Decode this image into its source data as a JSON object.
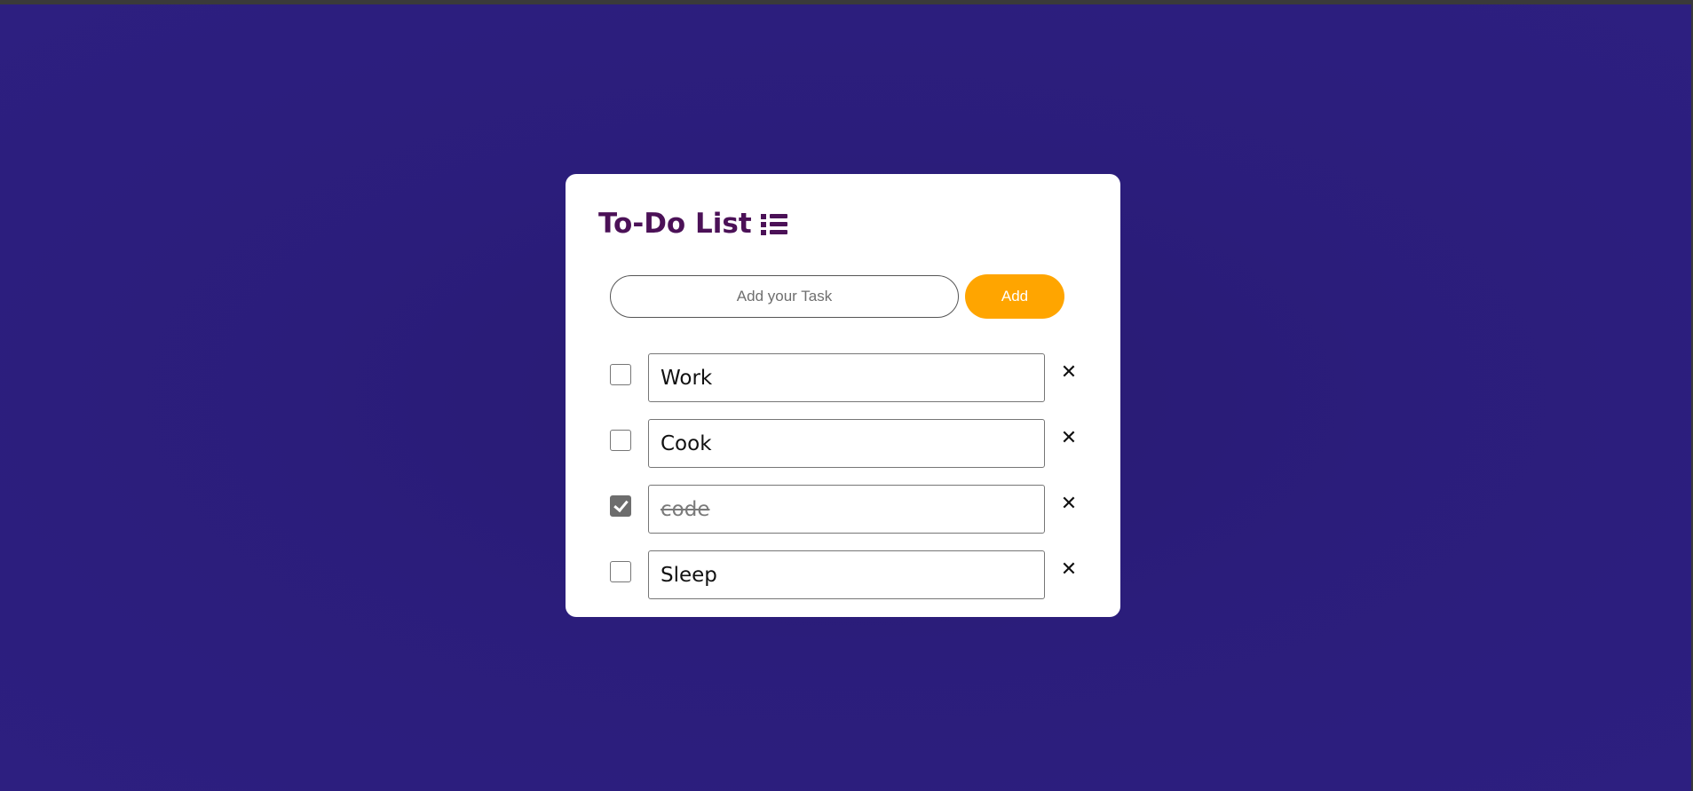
{
  "app": {
    "title": "To-Do List"
  },
  "add_form": {
    "placeholder": "Add your Task",
    "value": "",
    "button_label": "Add"
  },
  "todos": [
    {
      "text": "Work",
      "done": false
    },
    {
      "text": "Cook",
      "done": false
    },
    {
      "text": "code",
      "done": true
    },
    {
      "text": "Sleep",
      "done": false
    }
  ],
  "icons": {
    "title_icon": "list-icon",
    "delete_icon": "close-icon",
    "delete_glyph": "✕"
  },
  "colors": {
    "background": "#2c1e7c",
    "title": "#4b1157",
    "add_button": "#ffa500",
    "card": "#ffffff"
  }
}
